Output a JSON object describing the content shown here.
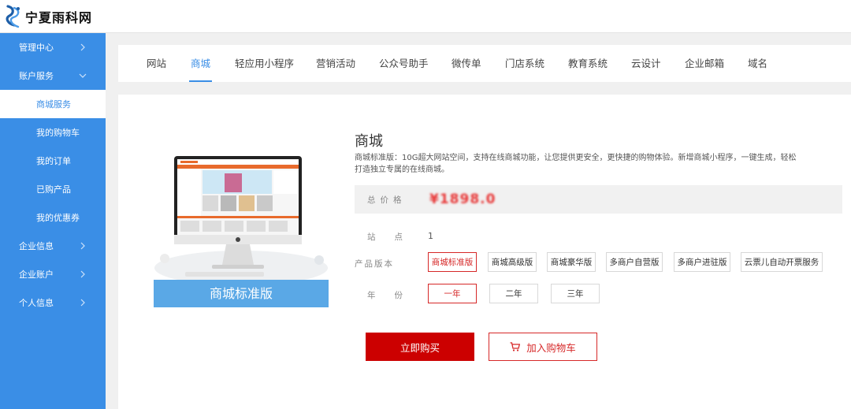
{
  "brand": {
    "name": "宁夏雨科网"
  },
  "sidebar": {
    "items": [
      {
        "label": "管理中心",
        "type": "group",
        "chevron": "chevron-right"
      },
      {
        "label": "账户服务",
        "type": "group",
        "chevron": "chevron-down"
      },
      {
        "label": "商城服务",
        "type": "sub",
        "active": true
      },
      {
        "label": "我的购物车",
        "type": "sub"
      },
      {
        "label": "我的订单",
        "type": "sub"
      },
      {
        "label": "已购产品",
        "type": "sub"
      },
      {
        "label": "我的优惠券",
        "type": "sub"
      },
      {
        "label": "企业信息",
        "type": "group",
        "chevron": "chevron-right"
      },
      {
        "label": "企业账户",
        "type": "group",
        "chevron": "chevron-right"
      },
      {
        "label": "个人信息",
        "type": "group",
        "chevron": "chevron-right"
      }
    ]
  },
  "tabs": [
    {
      "label": "网站"
    },
    {
      "label": "商城",
      "active": true
    },
    {
      "label": "轻应用小程序"
    },
    {
      "label": "营销活动"
    },
    {
      "label": "公众号助手"
    },
    {
      "label": "微传单"
    },
    {
      "label": "门店系统"
    },
    {
      "label": "教育系统"
    },
    {
      "label": "云设计"
    },
    {
      "label": "企业邮箱"
    },
    {
      "label": "域名"
    }
  ],
  "product": {
    "image_caption": "商城标准版",
    "title": "商城",
    "description": "商城标准版：10G超大网站空间，支持在线商城功能，让您提供更安全，更快捷的购物体验。新增商城小程序，一键生成，轻松打造独立专属的在线商城。",
    "price_label": "总价格",
    "price_value": "¥1898.0",
    "station_label": "站点",
    "station_value": "1",
    "version_label": "产品版本",
    "versions": [
      "商城标准版",
      "商城高级版",
      "商城豪华版",
      "多商户自营版",
      "多商户进驻版",
      "云票儿自动开票服务"
    ],
    "selected_version": "商城标准版",
    "year_label": "年份",
    "years": [
      "一年",
      "二年",
      "三年"
    ],
    "selected_year": "一年",
    "buy_label": "立即购买",
    "cart_label": "加入购物车"
  },
  "colors": {
    "sidebar": "#3a8ee6",
    "accent": "#3a8ee6",
    "buy_button": "#cc0000",
    "selected_border": "#d62828",
    "price": "#e83a3a"
  },
  "icons": {
    "logo": "logo-mark-icon",
    "cart": "shopping-cart-icon"
  }
}
